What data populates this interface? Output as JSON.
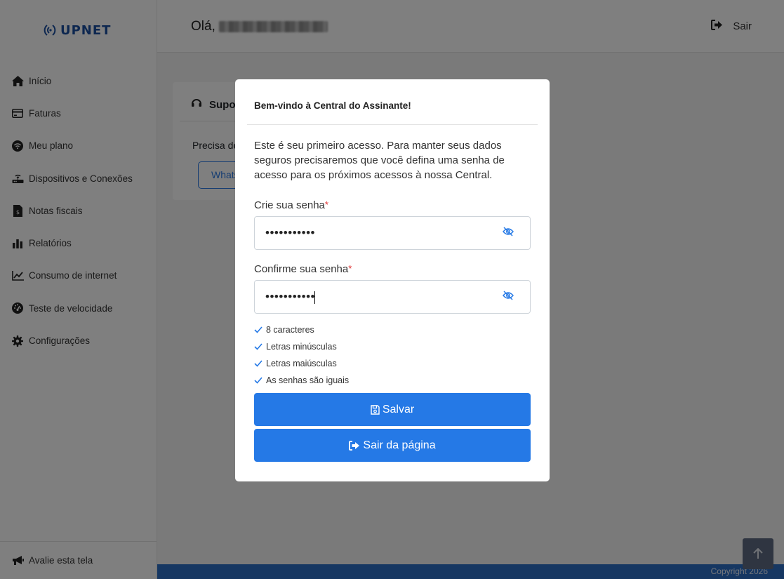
{
  "brand": {
    "name": "UPNET",
    "color": "#1a4fa0"
  },
  "sidebar": {
    "items": [
      {
        "label": "Início",
        "icon": "home-icon"
      },
      {
        "label": "Faturas",
        "icon": "credit-card-icon"
      },
      {
        "label": "Meu plano",
        "icon": "wifi-icon"
      },
      {
        "label": "Dispositivos e Conexões",
        "icon": "router-icon"
      },
      {
        "label": "Notas fiscais",
        "icon": "invoice-icon"
      },
      {
        "label": "Relatórios",
        "icon": "bar-chart-icon"
      },
      {
        "label": "Consumo de internet",
        "icon": "line-chart-icon"
      },
      {
        "label": "Teste de velocidade",
        "icon": "speedometer-icon"
      },
      {
        "label": "Configurações",
        "icon": "gear-icon"
      }
    ],
    "footer_label": "Avalie esta tela"
  },
  "header": {
    "greeting": "Olá,",
    "logout_label": "Sair"
  },
  "support_card": {
    "title": "Supo",
    "text": "Precisa de",
    "button": "Whats"
  },
  "modal": {
    "title": "Bem-vindo à Central do Assinante!",
    "description": "Este é seu primeiro acesso. Para manter seus dados seguros precisaremos que você defina uma senha de acesso para os próximos acessos à nossa Central.",
    "password_label": "Crie sua senha",
    "password_value": "•••••••••••",
    "confirm_label": "Confirme sua senha",
    "confirm_value": "•••••••••••",
    "required_mark": "*",
    "checks": [
      "8 caracteres",
      "Letras minúsculas",
      "Letras maiúsculas",
      "As senhas são iguais"
    ],
    "save_label": "Salvar",
    "exit_label": "Sair da página"
  },
  "footer": {
    "copyright": "Copyright 2026"
  },
  "colors": {
    "accent": "#2579e6",
    "check": "#2579e6",
    "required": "#e03131",
    "footer": "#2c6ec4"
  }
}
